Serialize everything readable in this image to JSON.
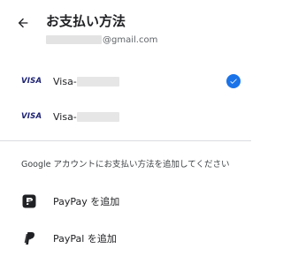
{
  "header": {
    "title": "お支払い方法",
    "email_suffix": "@gmail.com",
    "back_icon": "arrow-left-icon"
  },
  "cards": [
    {
      "brand": "VISA",
      "label": "Visa-",
      "selected": true
    },
    {
      "brand": "VISA",
      "label": "Visa-",
      "selected": false
    }
  ],
  "add_section": {
    "label": "Google アカウントにお支払い方法を追加してください",
    "options": [
      {
        "label": "PayPay を追加",
        "icon": "paypay-icon"
      },
      {
        "label": "PayPal を追加",
        "icon": "paypal-icon"
      }
    ]
  },
  "colors": {
    "accent": "#1a73e8",
    "visa": "#1a1f71",
    "divider": "#dadce0"
  }
}
